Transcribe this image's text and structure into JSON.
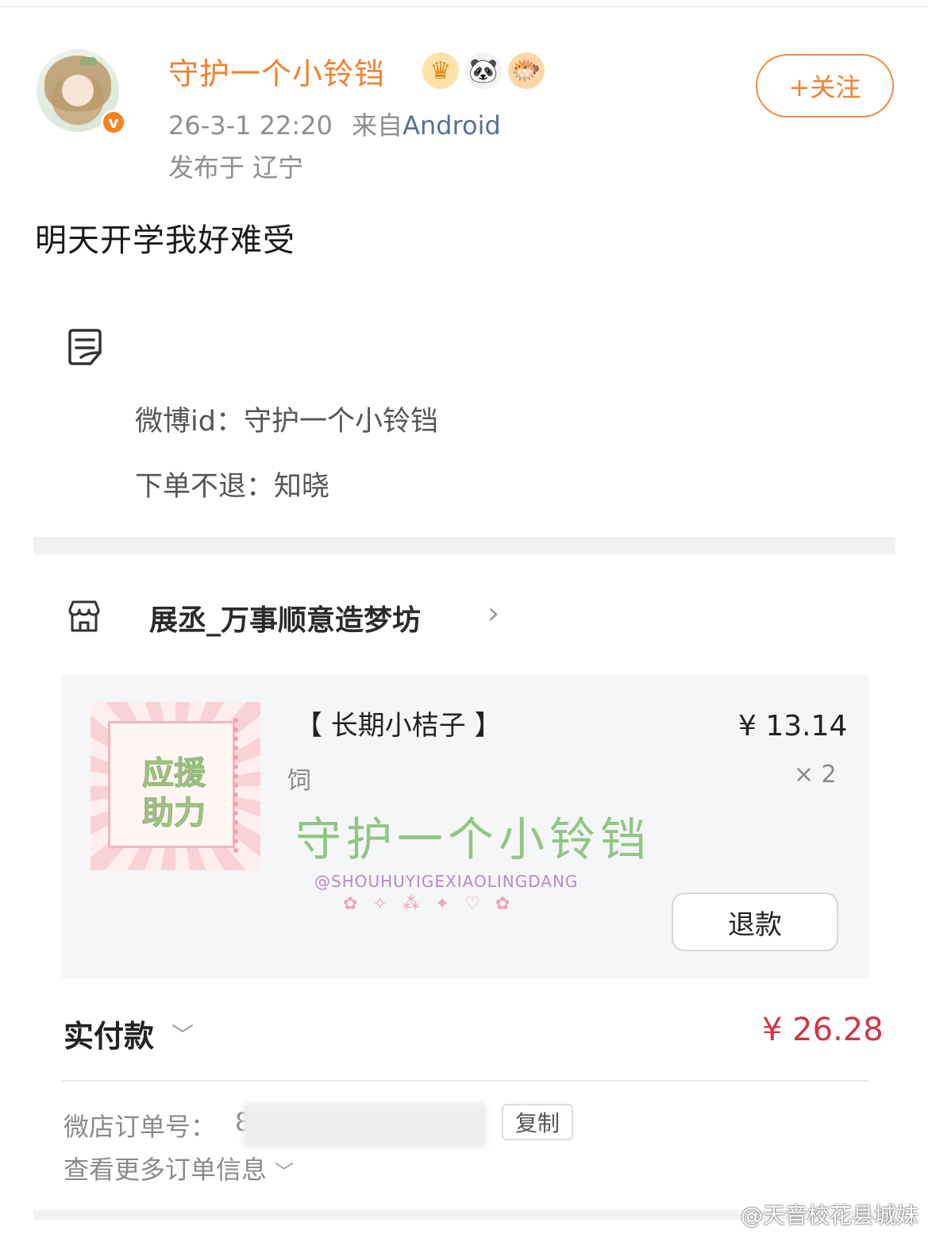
{
  "post": {
    "username": "守护一个小铃铛",
    "time": "26-3-1 22:20",
    "from_prefix": "来自",
    "source": "Android",
    "location": "发布于 辽宁",
    "follow_label": "+关注",
    "text": "明天开学我好难受",
    "badges": [
      "crown-badge",
      "panda-badge",
      "fish-badge"
    ]
  },
  "order": {
    "remark_lines": [
      "微博id：守护一个小铃铛",
      "下单不退：知晓"
    ],
    "shop_name": "展丞_万事顺意造梦坊",
    "product": {
      "title": "【 长期小桔子 】",
      "spec": "饲",
      "price": "¥ 13.14",
      "quantity": "× 2",
      "watermark_main": "守护一个小铃铛",
      "watermark_sub": "@SHOUHUYIGEXIAOLINGDANG"
    },
    "refund_label": "退款",
    "paid_label": "实付款",
    "paid_amount": "¥ 26.28",
    "order_no_label": "微店订单号：",
    "order_no_prefix": "8",
    "copy_label": "复制",
    "more_info_label": "查看更多订单信息"
  },
  "site_watermark": "@天音校花县城妹",
  "colors": {
    "accent_orange": "#f08130",
    "price_red": "#d0354a",
    "link_blue": "#5b6f96"
  }
}
